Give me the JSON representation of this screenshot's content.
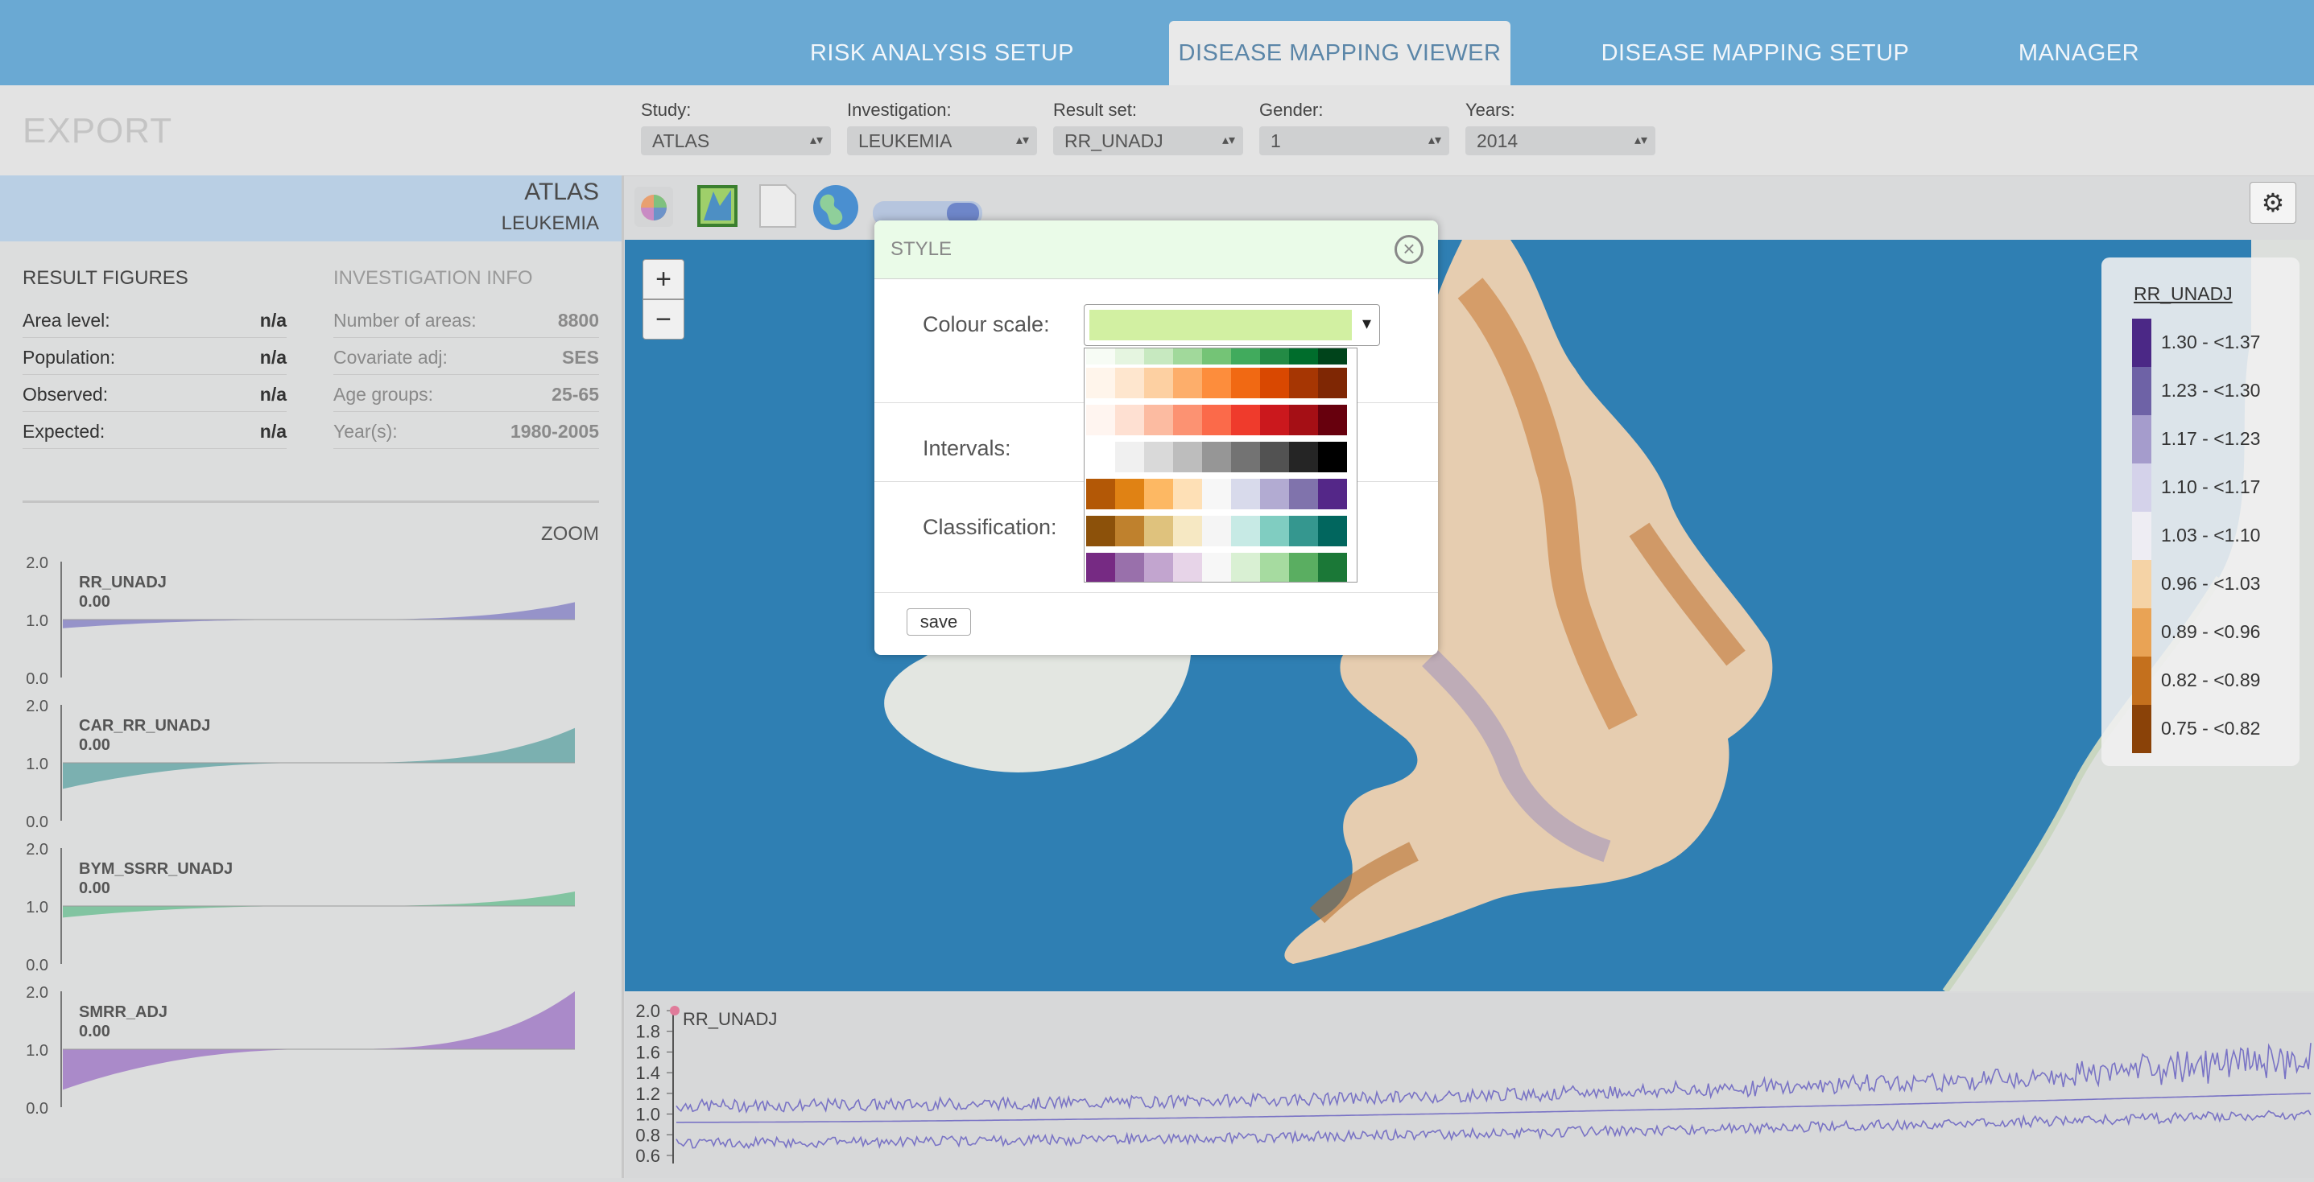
{
  "nav": {
    "tabs": [
      {
        "label": "RISK ANALYSIS SETUP"
      },
      {
        "label": "DISEASE MAPPING VIEWER"
      },
      {
        "label": "DISEASE MAPPING SETUP"
      },
      {
        "label": "MANAGER"
      }
    ],
    "active_tab": "DISEASE MAPPING VIEWER"
  },
  "subbar": {
    "export_label": "EXPORT",
    "selectors": [
      {
        "label": "Study:",
        "value": "ATLAS"
      },
      {
        "label": "Investigation:",
        "value": "LEUKEMIA"
      },
      {
        "label": "Result set:",
        "value": "RR_UNADJ"
      },
      {
        "label": "Gender:",
        "value": "1"
      },
      {
        "label": "Years:",
        "value": "2014"
      }
    ]
  },
  "left_panel": {
    "study": "ATLAS",
    "investigation": "LEUKEMIA",
    "result_figures": {
      "title": "RESULT FIGURES",
      "rows": [
        {
          "key": "Area level:",
          "value": "n/a"
        },
        {
          "key": "Population:",
          "value": "n/a"
        },
        {
          "key": "Observed:",
          "value": "n/a"
        },
        {
          "key": "Expected:",
          "value": "n/a"
        }
      ]
    },
    "investigation_info": {
      "title": "INVESTIGATION INFO",
      "rows": [
        {
          "key": "Number of areas:",
          "value": "8800"
        },
        {
          "key": "Covariate adj:",
          "value": "SES"
        },
        {
          "key": "Age groups:",
          "value": "25-65"
        },
        {
          "key": "Year(s):",
          "value": "1980-2005"
        }
      ]
    },
    "zoom_label": "ZOOM",
    "mini_charts": [
      {
        "name": "RR_UNADJ",
        "value": "0.00",
        "color": "#8a86c5",
        "ticks": [
          "2.0",
          "1.0",
          "0.0"
        ]
      },
      {
        "name": "CAR_RR_UNADJ",
        "value": "0.00",
        "color": "#6aa8a8",
        "ticks": [
          "2.0",
          "1.0",
          "0.0"
        ]
      },
      {
        "name": "BYM_SSRR_UNADJ",
        "value": "0.00",
        "color": "#72bf97",
        "ticks": [
          "2.0",
          "1.0",
          "0.0"
        ]
      },
      {
        "name": "SMRR_ADJ",
        "value": "0.00",
        "color": "#a17bc6",
        "ticks": [
          "2.0",
          "1.0",
          "0.0"
        ]
      }
    ]
  },
  "toolbar": {
    "icons": [
      "colour-wheel-icon",
      "map-style-icon",
      "document-icon",
      "globe-icon"
    ],
    "settings_icon": "gear-icon"
  },
  "map_controls": {
    "zoom_in": "+",
    "zoom_out": "−"
  },
  "legend": {
    "title": "RR_UNADJ",
    "items": [
      {
        "label": "1.30 - <1.37",
        "color": "#4b2886"
      },
      {
        "label": "1.23 - <1.30",
        "color": "#6e62a6"
      },
      {
        "label": "1.17 - <1.23",
        "color": "#a59ccc"
      },
      {
        "label": "1.10 - <1.17",
        "color": "#d4d2ea"
      },
      {
        "label": "1.03 - <1.10",
        "color": "#eeedf3"
      },
      {
        "label": "0.96 - <1.03",
        "color": "#f5d3a6"
      },
      {
        "label": "0.89 - <0.96",
        "color": "#e9a355"
      },
      {
        "label": "0.82 - <0.89",
        "color": "#c4701d"
      },
      {
        "label": "0.75 - <0.82",
        "color": "#8a4208"
      }
    ]
  },
  "bottom_chart": {
    "series_name": "RR_UNADJ",
    "y_ticks": [
      "2.0",
      "1.8",
      "1.6",
      "1.4",
      "1.2",
      "1.0",
      "0.8",
      "0.6"
    ],
    "ylim": [
      0.6,
      2.0
    ],
    "line_color": "#6f68c2"
  },
  "modal": {
    "title": "STYLE",
    "close_icon": "close-icon",
    "colour_scale_label": "Colour scale:",
    "selected_swatch_color": "#d2f0a2",
    "intervals_label": "Intervals:",
    "classification_label": "Classification:",
    "save_label": "save",
    "palettes": [
      [
        "#f7fcf5",
        "#e5f5e0",
        "#c7e9c0",
        "#a1d99b",
        "#74c476",
        "#41ab5d",
        "#238b45",
        "#006d2c",
        "#00441b"
      ],
      [
        "#fff5eb",
        "#fee6ce",
        "#fdd0a2",
        "#fdae6b",
        "#fd8d3c",
        "#f16913",
        "#d94801",
        "#a63603",
        "#7f2704"
      ],
      [
        "#fff5f0",
        "#fee0d2",
        "#fcbba1",
        "#fc9272",
        "#fb6a4a",
        "#ef3b2c",
        "#cb181d",
        "#a50f15",
        "#67000d"
      ],
      [
        "#ffffff",
        "#f0f0f0",
        "#d9d9d9",
        "#bdbdbd",
        "#969696",
        "#737373",
        "#525252",
        "#252525",
        "#000000"
      ],
      [
        "#b35806",
        "#e08214",
        "#fdb863",
        "#fee0b6",
        "#f7f7f7",
        "#d8daeb",
        "#b2abd2",
        "#8073ac",
        "#542788"
      ],
      [
        "#8c510a",
        "#bf812d",
        "#dfc27d",
        "#f6e8c3",
        "#f5f5f5",
        "#c7eae5",
        "#80cdc1",
        "#35978f",
        "#01665e"
      ],
      [
        "#762a83",
        "#9970ab",
        "#c2a5cf",
        "#e7d4e8",
        "#f7f7f7",
        "#d9f0d3",
        "#a6dba0",
        "#5aae61",
        "#1b7837"
      ],
      [
        "#c51b7d",
        "#de77ae",
        "#f1b6da",
        "#fde0ef",
        "#f7f7f7",
        "#e6f5d0",
        "#b8e186",
        "#7fbc41",
        "#4d9221"
      ]
    ]
  }
}
